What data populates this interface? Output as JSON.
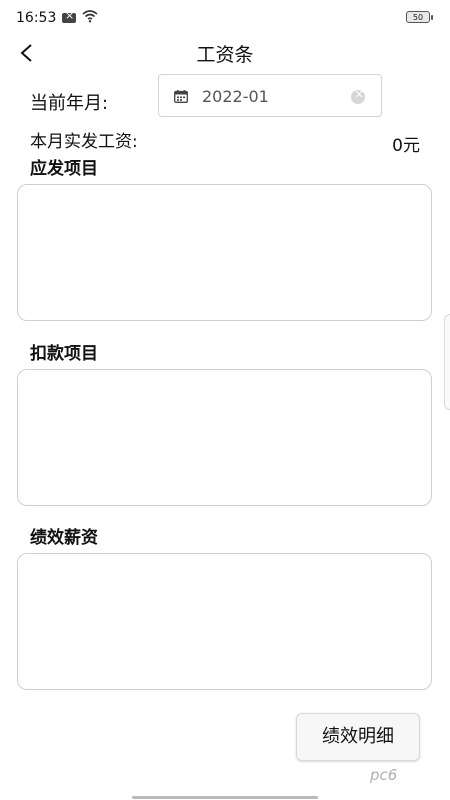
{
  "status_bar": {
    "time": "16:53",
    "battery": "50"
  },
  "header": {
    "title": "工资条"
  },
  "month": {
    "label": "当前年月:",
    "value": "2022-01"
  },
  "salary": {
    "label": "本月实发工资:",
    "value": "0元"
  },
  "sections": [
    {
      "title": "应发项目"
    },
    {
      "title": "扣款项目"
    },
    {
      "title": "绩效薪资"
    }
  ],
  "detail_button": {
    "label": "绩效明细"
  },
  "watermark": {
    "text": "pc6"
  }
}
